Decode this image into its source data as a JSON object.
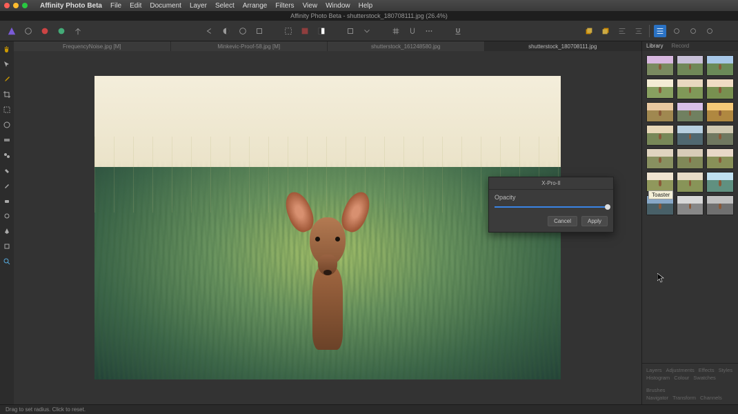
{
  "mac_menu": {
    "app_name": "Affinity Photo Beta",
    "items": [
      "File",
      "Edit",
      "Document",
      "Layer",
      "Select",
      "Arrange",
      "Filters",
      "View",
      "Window",
      "Help"
    ]
  },
  "window": {
    "title": "Affinity Photo Beta - shutterstock_180708111.jpg (26.4%)"
  },
  "toolbar": {
    "personas": [
      "logo-icon",
      "develop-icon",
      "liquify-icon",
      "tone-icon",
      "export-icon"
    ],
    "center1": [
      "undo-icon",
      "contrast-icon",
      "circle-icon",
      "select-icon"
    ],
    "center2": [
      "marquee-icon",
      "overlay-icon",
      "mask-icon"
    ],
    "center3": [
      "crop-icon",
      "dropdown-icon"
    ],
    "center4": [
      "grid-icon",
      "snap-icon",
      "more-icon"
    ],
    "center5": [
      "underline-icon"
    ],
    "right": [
      "layer1-icon",
      "layer2-icon",
      "align1-icon",
      "align2-icon",
      "separator",
      "list-icon",
      "gear1-icon",
      "gear2-icon",
      "gear3-icon"
    ]
  },
  "doc_tabs": [
    {
      "label": "FrequencyNoise.jpg [M]",
      "active": false
    },
    {
      "label": "Minkevic-Proof-58.jpg [M]",
      "active": false
    },
    {
      "label": "shutterstock_161248580.jpg",
      "active": false
    },
    {
      "label": "shutterstock_180708111.jpg",
      "active": true
    }
  ],
  "left_tools": [
    "hand-icon",
    "move-icon",
    "color-picker-icon",
    "crop-icon",
    "marquee-icon",
    "brush-neutral-icon",
    "gradient-icon",
    "clone-icon",
    "heal-icon",
    "paint-icon",
    "eraser-icon",
    "dodge-icon",
    "pen-icon",
    "shapes-icon",
    "zoom-icon"
  ],
  "fx_dialog": {
    "title": "X-Pro-II",
    "opacity_label": "Opacity",
    "opacity_value": 100,
    "cancel": "Cancel",
    "apply": "Apply"
  },
  "library": {
    "tabs": [
      "Library",
      "Record"
    ],
    "active_tab": "Library",
    "presets": [
      {
        "sky": "#d8b8e0",
        "ground": "#7a8a60"
      },
      {
        "sky": "#c8c0d8",
        "ground": "#708858"
      },
      {
        "sky": "#a8c8e8",
        "ground": "#6a8a58"
      },
      {
        "sky": "#f4ecd4",
        "ground": "#88a060"
      },
      {
        "sky": "#e8d8c0",
        "ground": "#809858"
      },
      {
        "sky": "#f0dcc4",
        "ground": "#789050"
      },
      {
        "sky": "#e8c8a0",
        "ground": "#a08850"
      },
      {
        "sky": "#d8c0e8",
        "ground": "#708060"
      },
      {
        "sky": "#f4c878",
        "ground": "#b08840"
      },
      {
        "sky": "#e8d8b8",
        "ground": "#788858"
      },
      {
        "sky": "#b8d0e0",
        "ground": "#506870"
      },
      {
        "sky": "#d0c8b0",
        "ground": "#707860"
      },
      {
        "sky": "#e0d4c0",
        "ground": "#889060"
      },
      {
        "sky": "#d8ccb8",
        "ground": "#808858"
      },
      {
        "sky": "#e8d8c8",
        "ground": "#889058"
      },
      {
        "sky": "#f0e4d0",
        "ground": "#90985c"
      },
      {
        "sky": "#e8dcc8",
        "ground": "#889458"
      },
      {
        "sky": "#c0e0f0",
        "ground": "#609080"
      },
      {
        "sky": "#88a8c8",
        "ground": "#486068"
      },
      {
        "sky": "#d8d8d8",
        "ground": "#888888"
      },
      {
        "sky": "#c0c0c0",
        "ground": "#707070"
      }
    ],
    "tooltip": "Toaster",
    "footer_rows": [
      [
        "Layers",
        "Adjustments",
        "Effects",
        "Styles"
      ],
      [
        "Histogram",
        "Colour",
        "Swatches",
        "Brushes"
      ],
      [
        "Navigator",
        "Transform",
        "Channels"
      ]
    ]
  },
  "statusbar": {
    "hint": "Drag to set radius. Click to reset."
  }
}
